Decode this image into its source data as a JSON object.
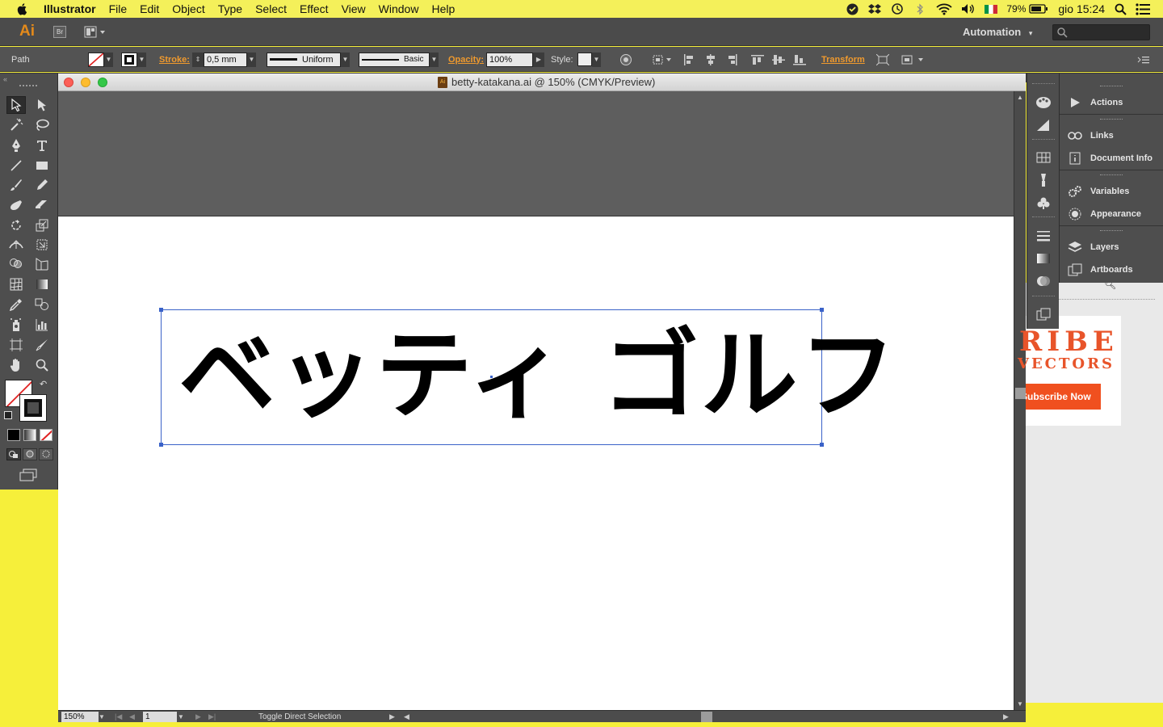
{
  "menubar": {
    "app_name": "Illustrator",
    "items": [
      "File",
      "Edit",
      "Object",
      "Type",
      "Select",
      "Effect",
      "View",
      "Window",
      "Help"
    ],
    "battery": "79%",
    "clock": "gio 15:24",
    "icons": [
      "apple-icon",
      "evernote-icon",
      "dropbox-icon",
      "time-machine-icon",
      "bluetooth-icon",
      "wifi-icon",
      "volume-icon",
      "italian-flag-icon",
      "battery-icon",
      "spotlight-icon",
      "notification-center-icon"
    ]
  },
  "appbar": {
    "logo": "Ai",
    "bridge_label": "Br",
    "workspace": "Automation"
  },
  "controlbar": {
    "selection_type": "Path",
    "stroke_label": "Stroke:",
    "stroke_value": "0,5 mm",
    "profile_label": "Uniform",
    "brush_label": "Basic",
    "opacity_label": "Opacity:",
    "opacity_value": "100%",
    "style_label": "Style:",
    "transform_label": "Transform"
  },
  "document": {
    "title": "betty-katakana.ai @ 150% (CMYK/Preview)",
    "artwork_text": "ベッティ ゴルフ"
  },
  "statusbar": {
    "zoom": "150%",
    "page": "1",
    "status_text": "Toggle Direct Selection"
  },
  "panels": {
    "items": [
      "Actions",
      "Links",
      "Document Info",
      "Variables",
      "Appearance",
      "Layers",
      "Artboards"
    ]
  },
  "background_site": {
    "headline": "RIBE",
    "subheadline": "VECTORS",
    "button": "Subscribe Now"
  },
  "colors": {
    "menubar_bg": "#f4f05a",
    "ui_dark": "#4e4e4e",
    "accent_orange": "#f09a2e",
    "selection_blue": "#3a62c8",
    "site_orange": "#f0501f"
  }
}
